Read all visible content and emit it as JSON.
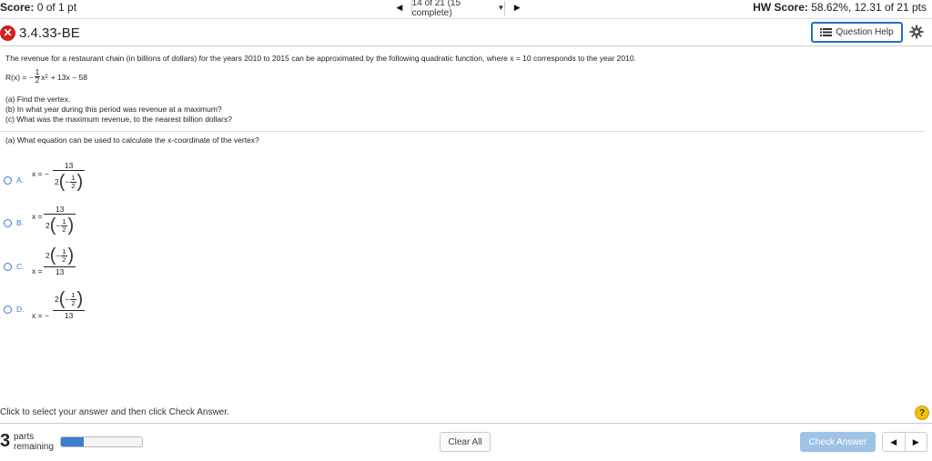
{
  "header": {
    "score_label": "Score:",
    "score_value": "0 of 1 pt",
    "nav_label": "14 of 21 (15 complete)",
    "hw_label": "HW Score:",
    "hw_value": "58.62%, 12.31 of 21 pts"
  },
  "question": {
    "id": "3.4.33-BE",
    "help_label": "Question Help",
    "prompt": "The revenue for a restaurant chain (in billions of dollars) for the years 2010 to 2015 can be approximated by the following quadratic function, where x = 10 corresponds to the year 2010.",
    "formula": {
      "lhs": "R(x) = −",
      "frac_num": "1",
      "frac_den": "2",
      "var": "x",
      "exp": "2",
      "rest": "+ 13x − 58"
    },
    "parts": [
      "(a) Find the vertex.",
      "(b) In what year during this period was revenue at a maximum?",
      "(c) What was the maximum revenue, to the nearest billion dollars?"
    ],
    "subquestion": "(a) What equation can be used to calculate the x-coordinate of the vertex?"
  },
  "options": [
    {
      "letter": "A.",
      "prefix": "x = −",
      "top": "13",
      "bottom_coef": "2",
      "minus": "−",
      "fn": "1",
      "fd": "2"
    },
    {
      "letter": "B.",
      "prefix": "x =",
      "top": "13",
      "bottom_coef": "2",
      "minus": "−",
      "fn": "1",
      "fd": "2"
    },
    {
      "letter": "C.",
      "prefix": "x =",
      "top_coef": "2",
      "minus": "−",
      "fn": "1",
      "fd": "2",
      "bottom": "13"
    },
    {
      "letter": "D.",
      "prefix": "x = −",
      "top_coef": "2",
      "minus": "−",
      "fn": "1",
      "fd": "2",
      "bottom": "13"
    }
  ],
  "footer": {
    "instruction": "Click to select your answer and then click Check Answer.",
    "help_glyph": "?",
    "parts_count": "3",
    "parts_line1": "parts",
    "parts_line2": "remaining",
    "progress_fraction": 0.28,
    "clear_label": "Clear All",
    "check_label": "Check Answer"
  },
  "colors": {
    "accent": "#3a7bd5",
    "error": "#d02020",
    "check_button": "#9fc3e6",
    "help_badge": "#f2c200"
  }
}
